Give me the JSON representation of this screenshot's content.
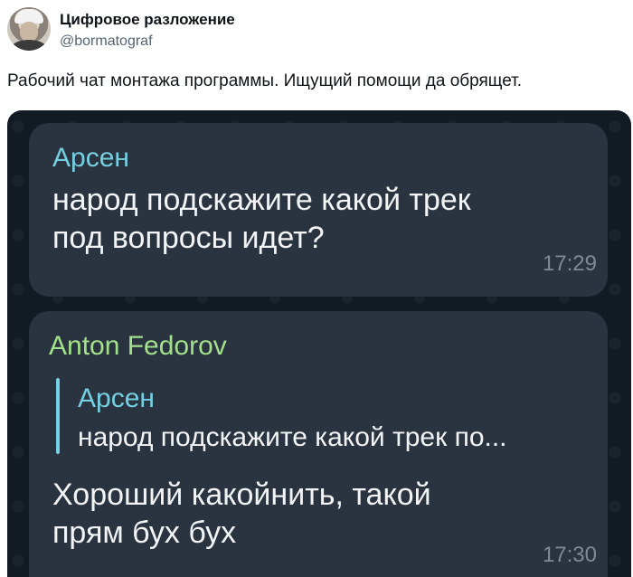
{
  "tweet": {
    "author_name": "Цифровое разложение",
    "author_handle": "@bormatograf",
    "text": "Рабочий чат монтажа программы. Ищущий помощи да обрящет."
  },
  "chat": {
    "messages": [
      {
        "sender": "Арсен",
        "text_lines": [
          "народ подскажите какой трек",
          "под вопросы идет?"
        ],
        "time": "17:29"
      },
      {
        "sender": "Anton Fedorov",
        "reply_to": {
          "sender": "Арсен",
          "text": "народ подскажите какой трек по..."
        },
        "text_lines": [
          "Хороший какойнить, такой",
          "прям бух бух"
        ],
        "time": "17:30"
      }
    ]
  },
  "colors": {
    "chat_background": "#121b24",
    "bubble": "#2a3440",
    "sender_arsen": "#76cfe1",
    "sender_anton": "#a3e08a",
    "timestamp": "#7f8a96"
  }
}
